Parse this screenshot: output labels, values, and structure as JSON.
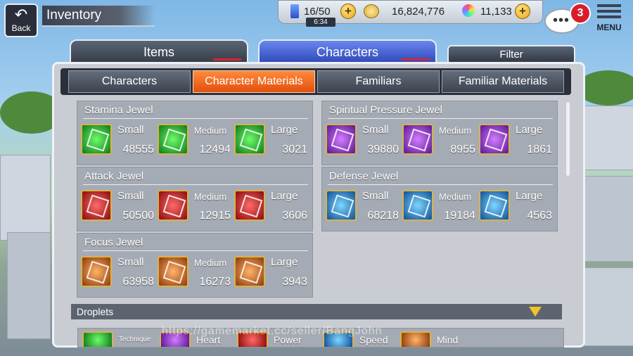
{
  "header": {
    "back_label": "Back",
    "title": "Inventory",
    "stamina": "16/50",
    "stamina_timer": "6:34",
    "coins": "16,824,776",
    "orbs": "11,133",
    "notification_count": "3",
    "menu_label": "MENU",
    "icons": {
      "back": "back-arrow-icon",
      "stamina": "stamina-icon",
      "coin": "coin-icon",
      "orb": "spirit-orb-icon",
      "chat": "chat-bubble-icon",
      "menu": "hamburger-menu-icon",
      "plus": "plus-icon"
    }
  },
  "main_tabs": [
    {
      "label": "Items",
      "active": false
    },
    {
      "label": "Characters",
      "active": true
    }
  ],
  "filter_label": "Filter",
  "sub_tabs": [
    {
      "label": "Characters",
      "active": false
    },
    {
      "label": "Character Materials",
      "active": true
    },
    {
      "label": "Familiars",
      "active": false
    },
    {
      "label": "Familiar Materials",
      "active": false
    }
  ],
  "jewel_groups": [
    {
      "title": "Stamina Jewel",
      "color": "#2fbf3a",
      "items": [
        {
          "size": "Small",
          "count": "48555"
        },
        {
          "size": "Medium",
          "count": "12494"
        },
        {
          "size": "Large",
          "count": "3021"
        }
      ]
    },
    {
      "title": "Spiritual Pressure Jewel",
      "color": "#9a3de0",
      "items": [
        {
          "size": "Small",
          "count": "39880"
        },
        {
          "size": "Medium",
          "count": "8955"
        },
        {
          "size": "Large",
          "count": "1861"
        }
      ]
    },
    {
      "title": "Attack Jewel",
      "color": "#d32a2a",
      "items": [
        {
          "size": "Small",
          "count": "50500"
        },
        {
          "size": "Medium",
          "count": "12915"
        },
        {
          "size": "Large",
          "count": "3606"
        }
      ]
    },
    {
      "title": "Defense Jewel",
      "color": "#2d8fe0",
      "items": [
        {
          "size": "Small",
          "count": "68218"
        },
        {
          "size": "Medium",
          "count": "19184"
        },
        {
          "size": "Large",
          "count": "4563"
        }
      ]
    },
    {
      "title": "Focus Jewel",
      "color": "#d9681e",
      "items": [
        {
          "size": "Small",
          "count": "63958"
        },
        {
          "size": "Medium",
          "count": "16273"
        },
        {
          "size": "Large",
          "count": "3943"
        }
      ]
    }
  ],
  "droplets": {
    "title": "Droplets",
    "items": [
      "Technique",
      "Heart",
      "Power",
      "Speed",
      "Mind"
    ]
  },
  "watermark": "https://gamemarket.cc/seller/BangJohn"
}
